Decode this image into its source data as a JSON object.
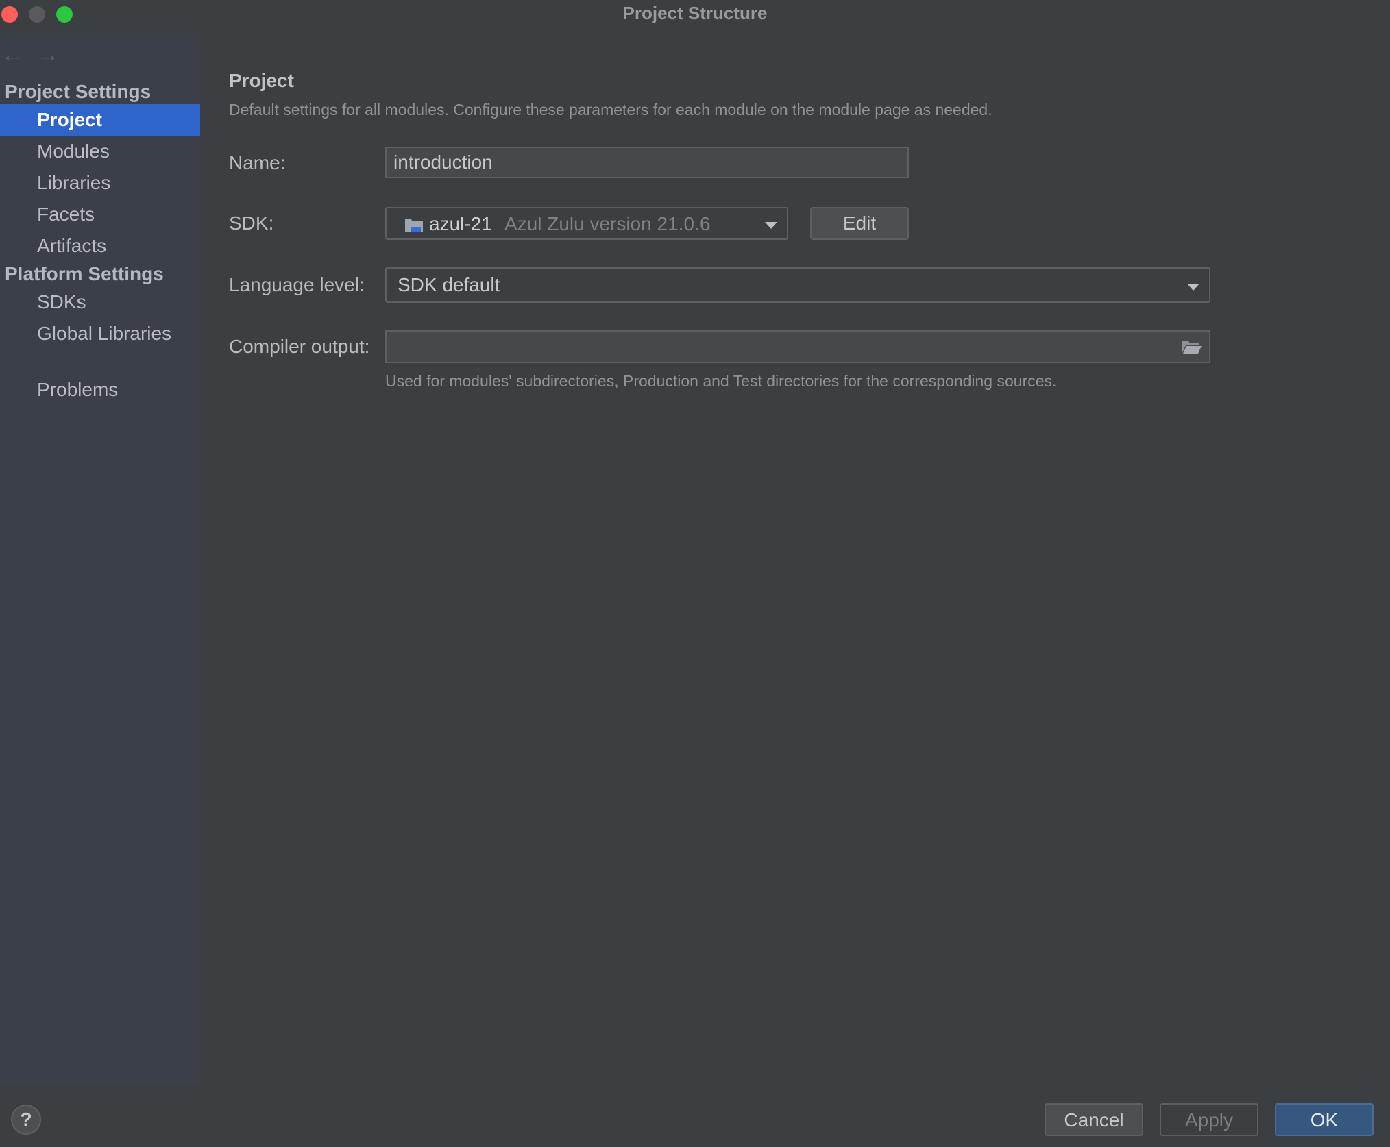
{
  "window": {
    "title": "Project Structure"
  },
  "sidebar": {
    "sections": [
      {
        "header": "Project Settings",
        "items": [
          {
            "label": "Project",
            "selected": true
          },
          {
            "label": "Modules"
          },
          {
            "label": "Libraries"
          },
          {
            "label": "Facets"
          },
          {
            "label": "Artifacts"
          }
        ]
      },
      {
        "header": "Platform Settings",
        "items": [
          {
            "label": "SDKs"
          },
          {
            "label": "Global Libraries"
          }
        ]
      }
    ],
    "problems_label": "Problems"
  },
  "main": {
    "title": "Project",
    "description": "Default settings for all modules. Configure these parameters for each module on the module page as needed.",
    "name": {
      "label": "Name:",
      "value": "introduction"
    },
    "sdk": {
      "label": "SDK:",
      "name": "azul-21",
      "version": "Azul Zulu version 21.0.6",
      "edit_label": "Edit"
    },
    "language_level": {
      "label": "Language level:",
      "value": "SDK default"
    },
    "compiler_output": {
      "label": "Compiler output:",
      "value": "",
      "hint": "Used for modules' subdirectories, Production and Test directories for the corresponding sources."
    }
  },
  "footer": {
    "help_label": "?",
    "cancel_label": "Cancel",
    "apply_label": "Apply",
    "ok_label": "OK"
  },
  "colors": {
    "accent": "#2f65ca",
    "ok_button": "#365880",
    "background": "#3c3f41",
    "sidebar_background": "#3b3f49"
  }
}
